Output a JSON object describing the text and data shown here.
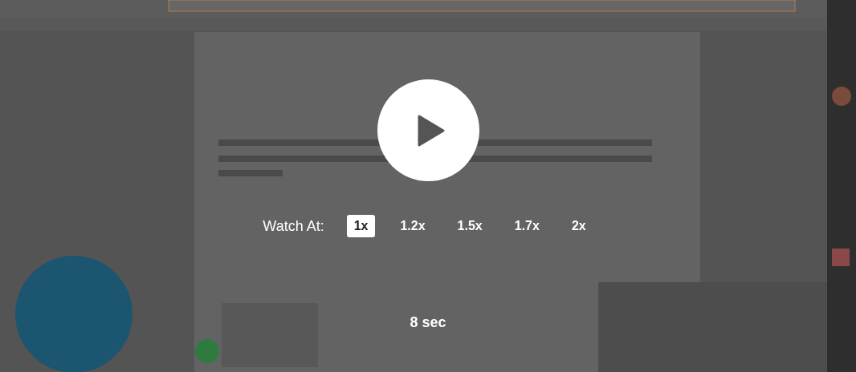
{
  "player": {
    "label": "Watch At:",
    "speeds": [
      {
        "label": "1x",
        "selected": true
      },
      {
        "label": "1.2x",
        "selected": false
      },
      {
        "label": "1.5x",
        "selected": false
      },
      {
        "label": "1.7x",
        "selected": false
      },
      {
        "label": "2x",
        "selected": false
      }
    ],
    "timer": "8 sec"
  }
}
